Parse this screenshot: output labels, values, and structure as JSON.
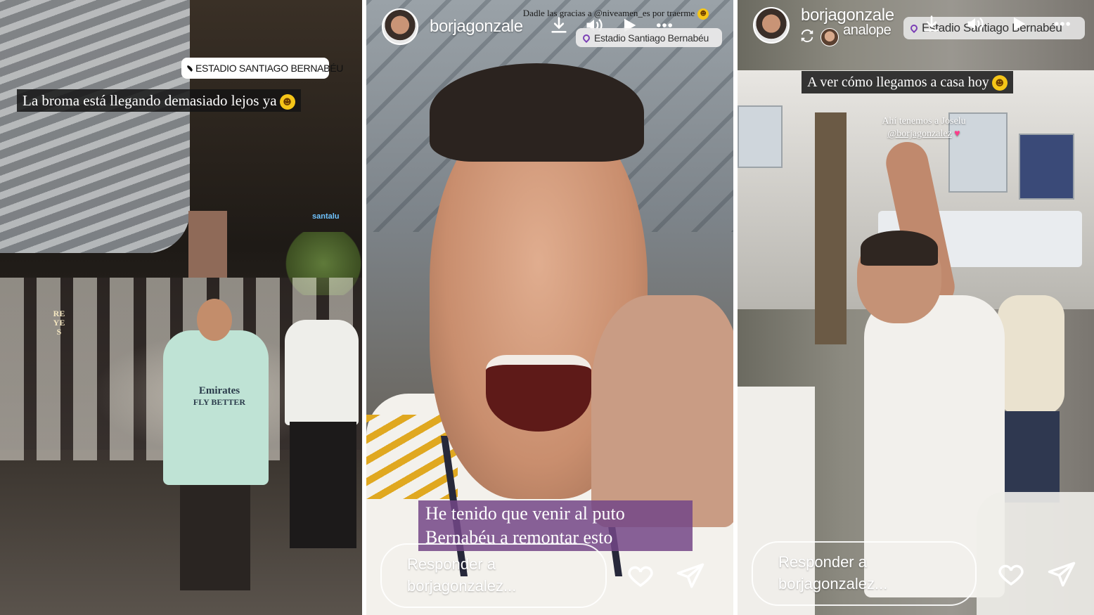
{
  "stories": [
    {
      "location": "ESTADIO SANTIAGO BERNABÉU",
      "caption": "La broma está llegando demasiado lejos ya",
      "scene_signs": [
        "santalu"
      ],
      "shirt_text": [
        "Emirates",
        "FLY BETTER"
      ],
      "scarf_text": "REYES"
    },
    {
      "username": "borjagonzale",
      "top_text": "Dadle las gracias a @niveamen_es por traerme",
      "location": "Estadio Santiago Bernabéu",
      "caption_line1": "He tenido que venir al puto",
      "caption_line2": "Bernabéu a remontar esto",
      "reply_line1": "Responder a",
      "reply_line2": "borjagonzalez..."
    },
    {
      "username": "borjagonzale",
      "sub_username": "analope",
      "location": "Estadio Santiago Bernabéu",
      "caption": "A ver cómo llegamos a casa hoy",
      "small_caption_line1": "Ahí tenemos a Joselu",
      "small_caption_line2": "@borjagonzalez",
      "reply_line1": "Responder a",
      "reply_line2": "borjagonzalez..."
    }
  ],
  "icons": {
    "location": "pin-icon",
    "download": "download-icon",
    "sound": "speaker-icon",
    "play": "play-icon",
    "more": "more-icon",
    "like": "heart-icon",
    "share": "send-icon",
    "emoji": "laughing-emoji-icon"
  },
  "colors": {
    "caption_bg_dark": "#141414",
    "caption_bg_purple": "#734687",
    "accent_pink": "#ff3b8a"
  }
}
